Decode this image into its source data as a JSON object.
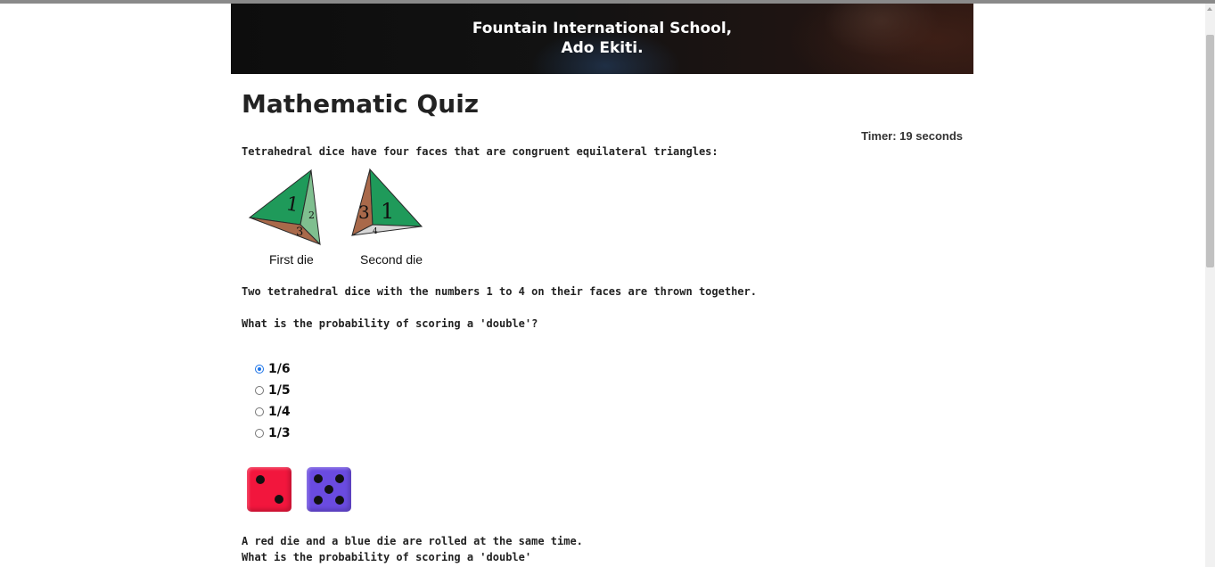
{
  "header": {
    "school_line1": "Fountain International School,",
    "school_line2": "Ado Ekiti."
  },
  "quiz": {
    "title": "Mathematic Quiz",
    "timer": "Timer: 19 seconds",
    "q1": {
      "intro": "Tetrahedral dice have four faces that are congruent equilateral triangles:",
      "figure": {
        "first_label": "First die",
        "second_label": "Second die",
        "first_faces": {
          "front": "1",
          "right": "2",
          "bottom": "3"
        },
        "second_faces": {
          "left": "3",
          "right": "1",
          "bottom": "4"
        }
      },
      "statement": "Two tetrahedral dice with the numbers 1 to 4 on their faces are thrown together.",
      "question": "What is the probability of scoring a 'double'?",
      "options": [
        "1/6",
        "1/5",
        "1/4",
        "1/3"
      ],
      "selected_option": "1/6"
    },
    "q2": {
      "statement": "A red die and a blue die are rolled at the same time.",
      "question": "What is the probability of scoring a 'double'",
      "red_die_value": 2,
      "blue_die_value": 5
    }
  },
  "colors": {
    "red_die": "#f2163d",
    "blue_die": "#6a4be0",
    "tetra_green": "#1f9a5a",
    "tetra_brown": "#a9694a",
    "radio_accent": "#1a73e8"
  }
}
